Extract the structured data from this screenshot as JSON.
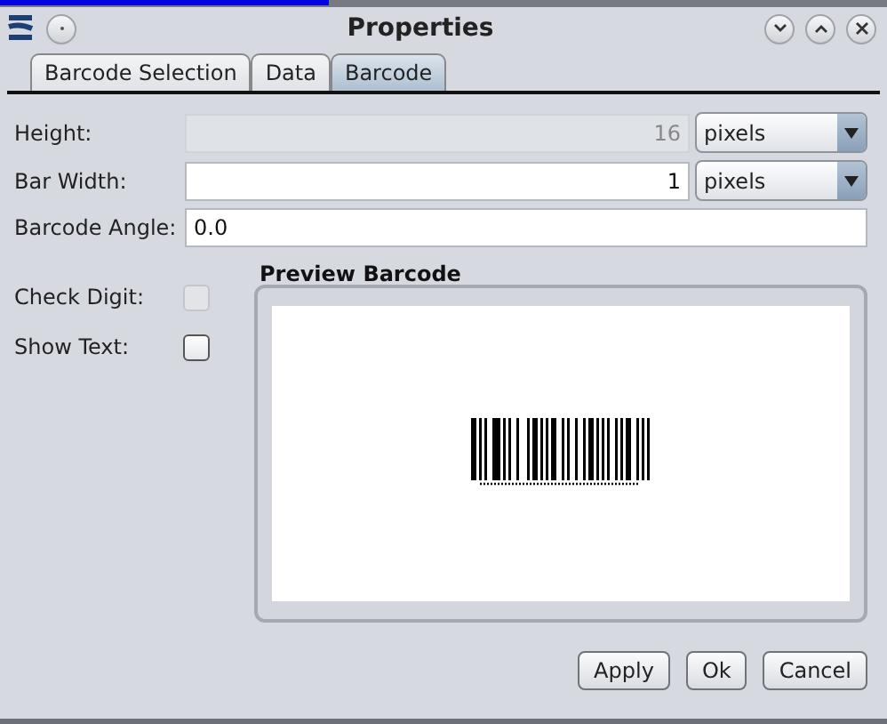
{
  "window": {
    "title": "Properties"
  },
  "tabs": [
    {
      "label": "Barcode Selection",
      "selected": false
    },
    {
      "label": "Data",
      "selected": false
    },
    {
      "label": "Barcode",
      "selected": true
    }
  ],
  "fields": [
    {
      "label": "Height:",
      "value": "16",
      "disabled": true,
      "unit": "pixels"
    },
    {
      "label": "Bar Width:",
      "value": "1",
      "disabled": false,
      "unit": "pixels"
    },
    {
      "label": "Barcode Angle:",
      "value": "0.0",
      "disabled": false
    }
  ],
  "checkboxes": [
    {
      "label": "Check Digit:",
      "checked": false,
      "disabled": true
    },
    {
      "label": "Show Text:",
      "checked": false,
      "disabled": false
    }
  ],
  "preview": {
    "title": "Preview Barcode"
  },
  "buttons": [
    "Apply",
    "Ok",
    "Cancel"
  ]
}
